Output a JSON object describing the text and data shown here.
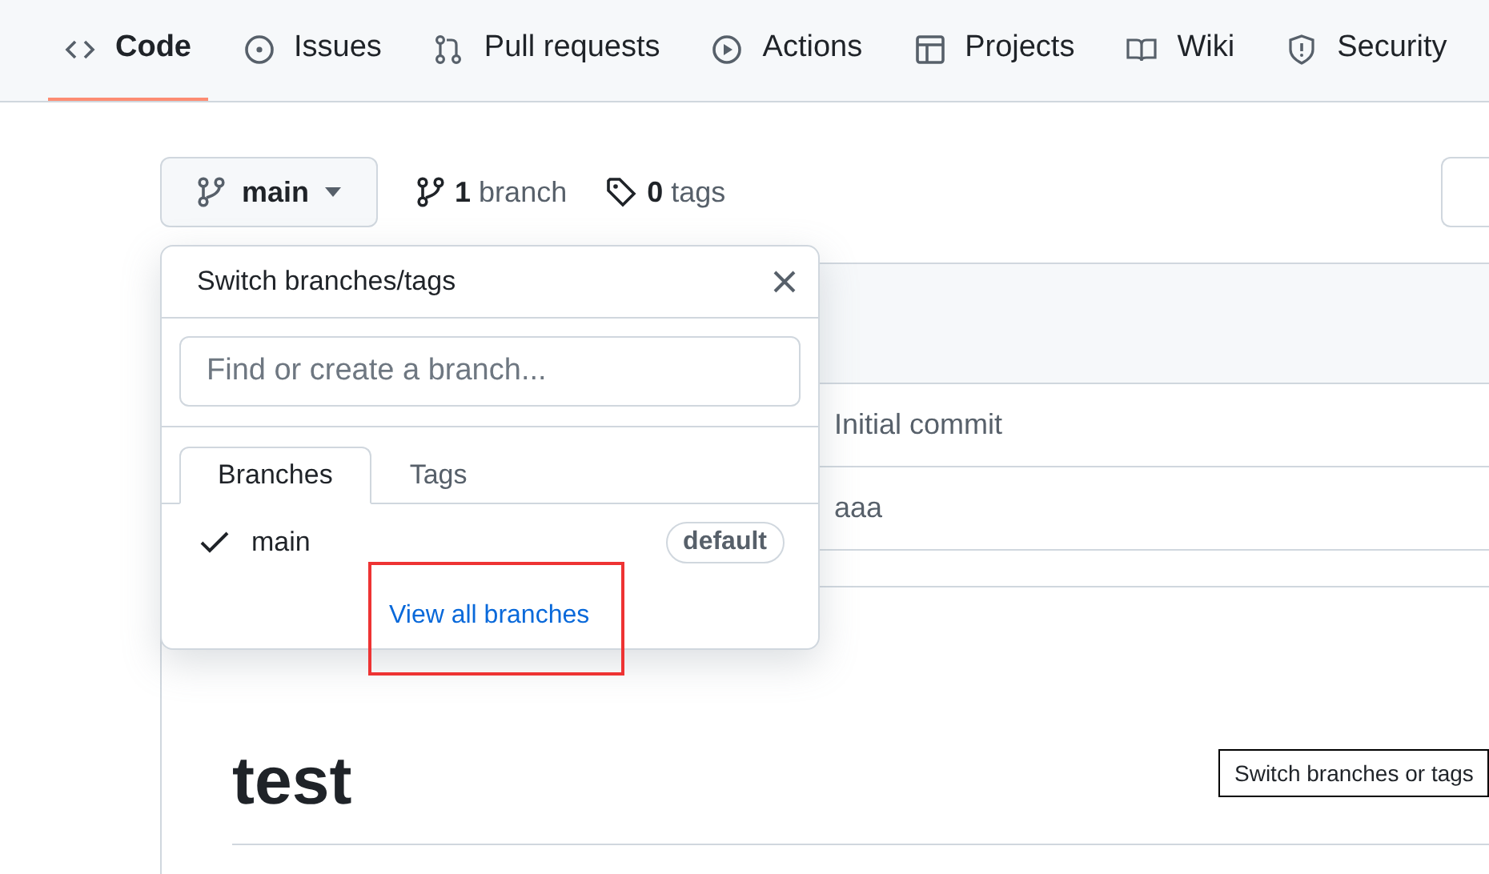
{
  "repo_tabs": [
    {
      "label": "Code",
      "selected": true
    },
    {
      "label": "Issues",
      "selected": false
    },
    {
      "label": "Pull requests",
      "selected": false
    },
    {
      "label": "Actions",
      "selected": false
    },
    {
      "label": "Projects",
      "selected": false
    },
    {
      "label": "Wiki",
      "selected": false
    },
    {
      "label": "Security",
      "selected": false
    }
  ],
  "branch_button": {
    "label": "main"
  },
  "branch_count": {
    "count": "1",
    "label": "branch"
  },
  "tag_count": {
    "count": "0",
    "label": "tags"
  },
  "commits": [
    {
      "message": "Initial commit"
    },
    {
      "message": "aaa"
    }
  ],
  "readme": {
    "heading": "test"
  },
  "dropdown": {
    "title": "Switch branches/tags",
    "placeholder": "Find or create a branch...",
    "tabs": [
      {
        "label": "Branches",
        "selected": true
      },
      {
        "label": "Tags",
        "selected": false
      }
    ],
    "branches": [
      {
        "name": "main",
        "checked": true,
        "badge": "default"
      }
    ],
    "link": "View all branches"
  },
  "tooltip": "Switch branches or tags"
}
